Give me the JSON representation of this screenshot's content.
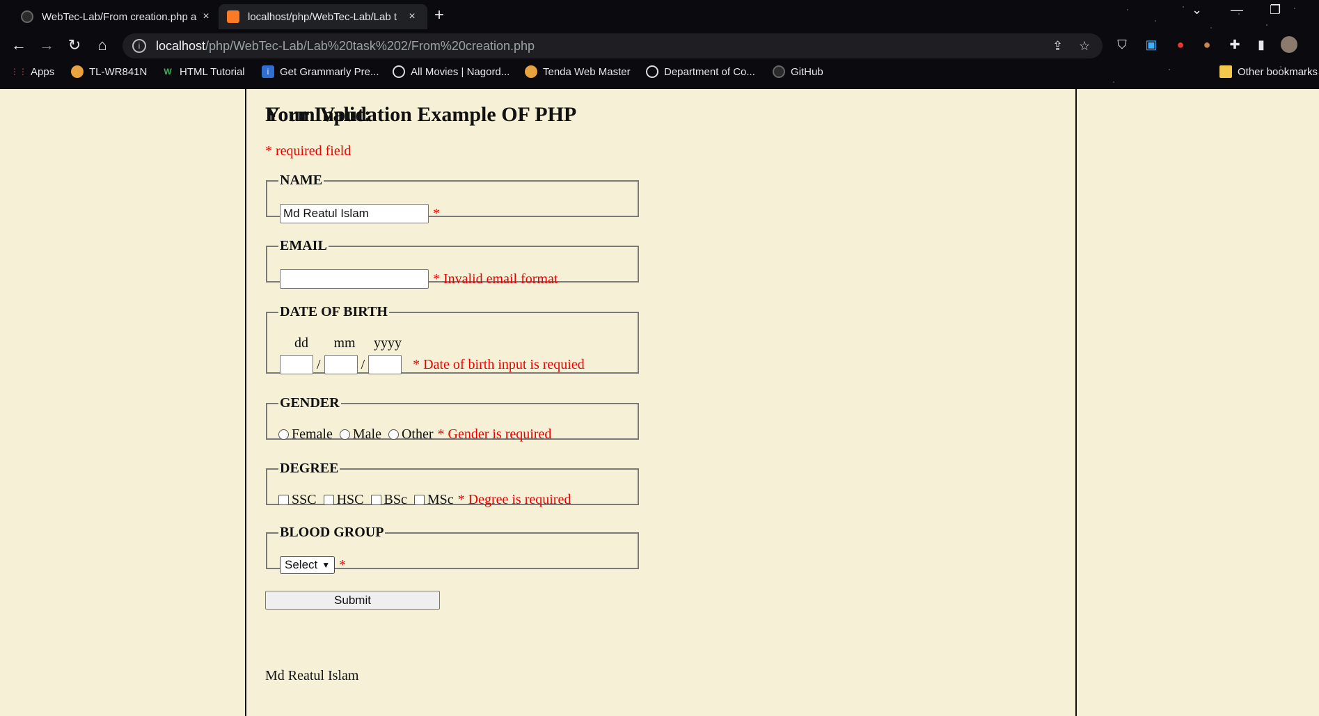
{
  "browser": {
    "tabs": [
      {
        "title": "WebTec-Lab/From creation.php a",
        "close": "×"
      },
      {
        "title": "localhost/php/WebTec-Lab/Lab t",
        "close": "×"
      }
    ],
    "new_tab": "+",
    "address": {
      "host": "localhost",
      "path": "/php/WebTec-Lab/Lab%20task%202/From%20creation.php"
    },
    "bookmarks": [
      {
        "label": "Apps",
        "icon": "apps-grid-icon"
      },
      {
        "label": "TL-WR841N",
        "icon": "tplink-icon"
      },
      {
        "label": "HTML Tutorial",
        "icon": "w3schools-icon"
      },
      {
        "label": "Get Grammarly Pre...",
        "icon": "info-icon"
      },
      {
        "label": "All Movies | Nagord...",
        "icon": "globe-icon"
      },
      {
        "label": "Tenda Web Master",
        "icon": "tenda-icon"
      },
      {
        "label": "Department of Co...",
        "icon": "globe-icon"
      },
      {
        "label": "GitHub",
        "icon": "github-icon"
      }
    ],
    "other_bookmarks": "Other bookmarks"
  },
  "form": {
    "title": "Form Validation Example OF PHP",
    "required_note": "* required field",
    "name": {
      "legend": "NAME",
      "value": "Md Reatul Islam",
      "error": "*"
    },
    "email": {
      "legend": "EMAIL",
      "value": "",
      "error": "* Invalid email format"
    },
    "dob": {
      "legend": "DATE OF BIRTH",
      "labels": [
        "dd",
        "mm",
        "yyyy"
      ],
      "sep": "/",
      "error": "* Date of birth input is requied"
    },
    "gender": {
      "legend": "GENDER",
      "options": [
        "Female",
        "Male",
        "Other"
      ],
      "error": "* Gender is required"
    },
    "degree": {
      "legend": "DEGREE",
      "options": [
        "SSC",
        "HSC",
        "BSc",
        "MSc"
      ],
      "error": "* Degree is required"
    },
    "blood_group": {
      "legend": "BLOOD GROUP",
      "selected": "Select",
      "error": "*"
    },
    "submit_label": "Submit"
  },
  "output": {
    "heading": "Your Input:",
    "name": "Md Reatul Islam"
  }
}
